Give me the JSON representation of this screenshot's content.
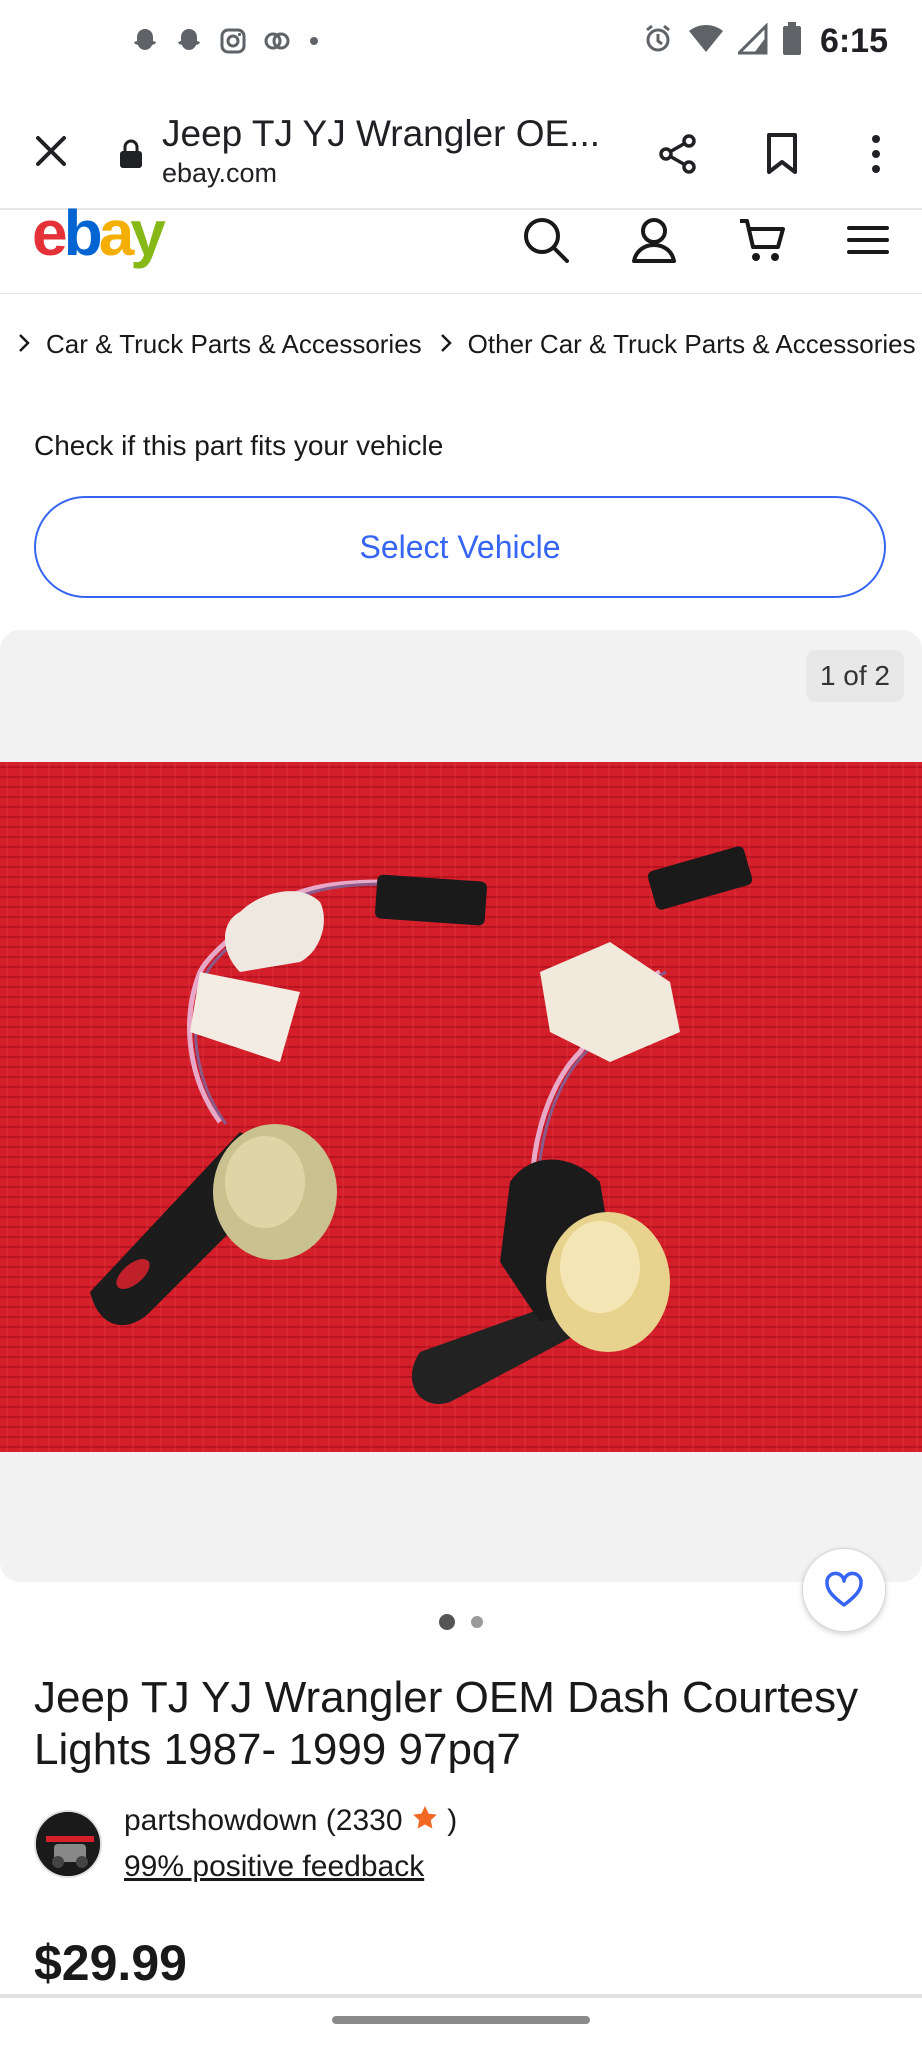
{
  "status_bar": {
    "time": "6:15",
    "left_icons": [
      "snapchat-icon",
      "snapchat-icon",
      "instagram-icon",
      "threads-icon",
      "dot-icon"
    ],
    "right_icons": [
      "alarm-icon",
      "wifi-icon",
      "signal-icon",
      "battery-icon"
    ]
  },
  "browser": {
    "title": "Jeep TJ YJ Wrangler OE...",
    "domain": "ebay.com"
  },
  "ebay_header": {
    "logo": {
      "e": "e",
      "b": "b",
      "a": "a",
      "y": "y"
    },
    "icons": [
      "search-icon",
      "account-icon",
      "cart-icon",
      "menu-icon"
    ]
  },
  "breadcrumbs": [
    "Car & Truck Parts & Accessories",
    "Other Car & Truck Parts & Accessories"
  ],
  "fitment": {
    "label": "Check if this part fits your vehicle",
    "button": "Select Vehicle"
  },
  "gallery": {
    "counter": "1 of 2",
    "current": 1,
    "total": 2
  },
  "item": {
    "title": "Jeep TJ YJ Wrangler OEM Dash Courtesy Lights 1987- 1999 97pq7",
    "seller_name": "partshowdown",
    "seller_score_open": "(2330",
    "seller_score_close": ")",
    "seller_feedback": "99% positive feedback",
    "price": "$29.99"
  },
  "colors": {
    "accent": "#3665f3",
    "logo_red": "#e53238",
    "logo_blue": "#0064d2",
    "logo_yellow": "#f5af02",
    "logo_green": "#86b817",
    "photo_background": "#d8202c",
    "star": "#f26722"
  }
}
